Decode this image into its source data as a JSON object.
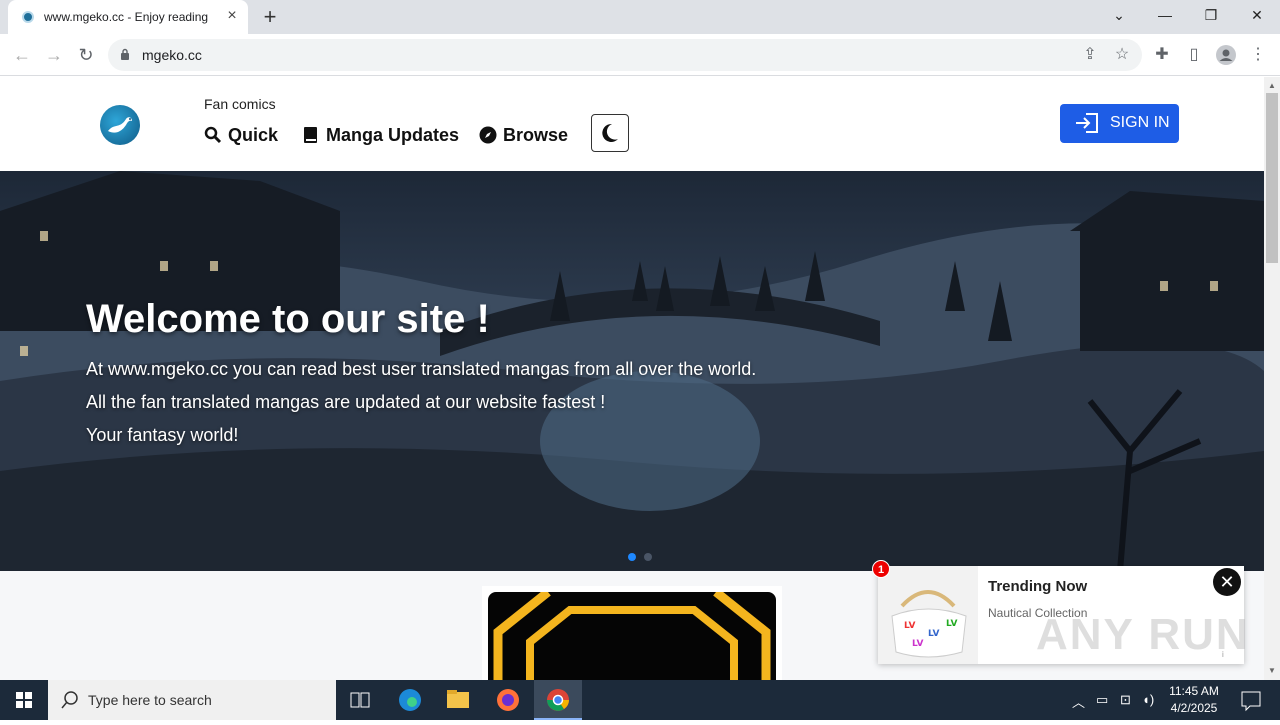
{
  "browser": {
    "tab_title": "www.mgeko.cc - Enjoy reading",
    "url": "mgeko.cc"
  },
  "header": {
    "tagline": "Fan comics",
    "nav": [
      {
        "label": "Quick",
        "icon": "search-icon"
      },
      {
        "label": "Manga Updates",
        "icon": "book-icon"
      },
      {
        "label": "Browse",
        "icon": "compass-icon"
      }
    ],
    "theme_icon": "moon-icon",
    "signin_label": "SIGN IN"
  },
  "hero": {
    "title": "Welcome to our site !",
    "lines": [
      "At www.mgeko.cc you can read best user translated mangas from all over the world.",
      "All the fan translated mangas are updated at our website fastest !",
      "Your fantasy world!"
    ],
    "slide_active": 1,
    "slide_count": 2
  },
  "popup": {
    "badge": "1",
    "title": "Trending Now",
    "subtitle": "Nautical Collection",
    "ad_label": "i"
  },
  "watermark": "ANY RUN",
  "taskbar": {
    "search_placeholder": "Type here to search",
    "time": "11:45 AM",
    "date": "4/2/2025"
  },
  "colors": {
    "accent": "#1e5de6",
    "taskbar": "#1c2a3a",
    "tab_strip": "#dee1e6"
  }
}
